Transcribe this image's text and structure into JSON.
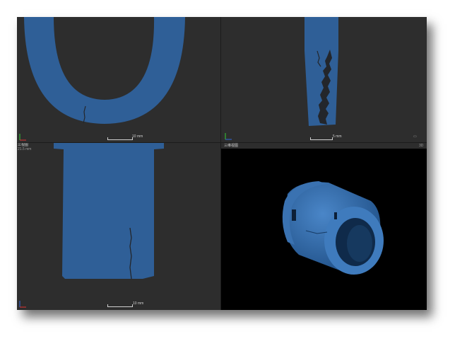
{
  "viewports": {
    "top_left": {
      "corner_label": "",
      "scale_label": "10 mm"
    },
    "top_right": {
      "corner_label": "",
      "scale_label": "5 mm"
    },
    "bottom_left": {
      "corner_label": "三视图",
      "distance_label": "21.5 mm",
      "scale_label": "10 mm"
    },
    "bottom_right": {
      "corner_label": "三维视图",
      "corner_right_label": "3D"
    }
  },
  "colors": {
    "background": "#2d2d2d",
    "part": "#2f5f97",
    "crack": "#23262b",
    "render_background": "#000000",
    "axis_x": "#d33",
    "axis_y": "#3c3",
    "axis_z": "#36d"
  }
}
